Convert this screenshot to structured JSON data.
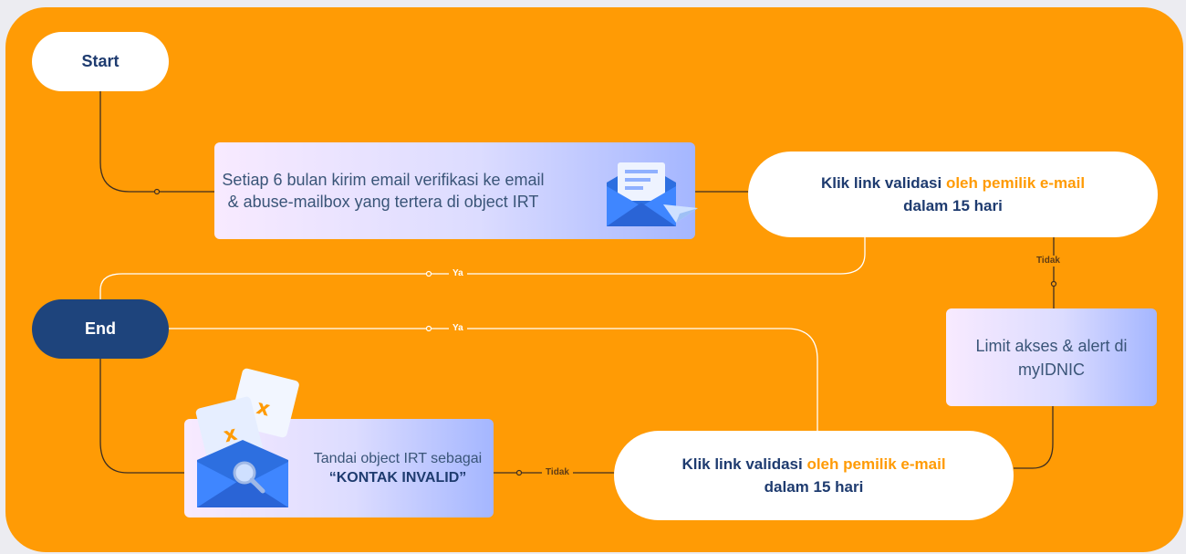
{
  "nodes": {
    "start": "Start",
    "end": "End",
    "send_verification": "Setiap 6 bulan kirim email verifikasi ke email & abuse-mailbox yang tertera di object IRT",
    "validate_top": {
      "part1": "Klik link validasi ",
      "part2": "oleh pemilik e-mail",
      "part3": " dalam 15 hari"
    },
    "validate_bottom": {
      "part1": "Klik link validasi ",
      "part2": "oleh pemilik e-mail",
      "part3": " dalam 15 hari"
    },
    "limit_access": "Limit akses & alert di myIDNIC",
    "mark_invalid": {
      "prefix": "Tandai object IRT sebagai ",
      "bold": "“KONTAK INVALID”"
    }
  },
  "edges": {
    "yes_top": "Ya",
    "yes_bottom": "Ya",
    "no_right": "Tidak",
    "no_bottom": "Tidak"
  },
  "colors": {
    "background": "#ff9b05",
    "navy": "#1e3b6f",
    "accent": "#ff9b05",
    "box_gradient_end": "#a4b6ff"
  },
  "icons": {
    "email_icon": "envelope-with-letter-and-paper-plane",
    "invalid_icon": "envelope-with-x-cards-and-magnifier"
  }
}
